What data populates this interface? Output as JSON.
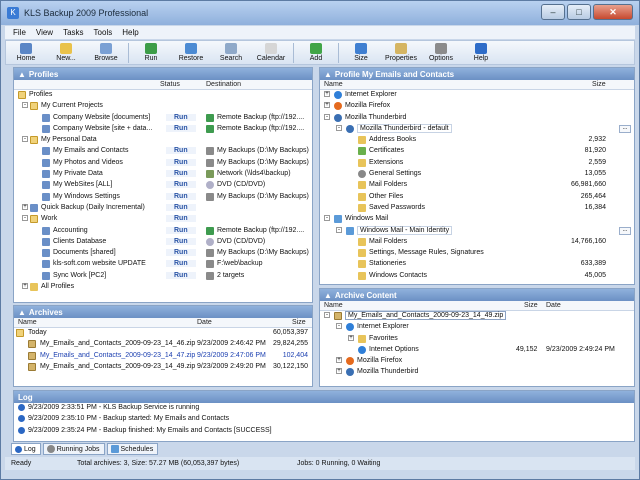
{
  "window": {
    "title": "KLS Backup 2009 Professional",
    "min": "–",
    "max": "□",
    "close": "✕"
  },
  "menu": [
    "File",
    "View",
    "Tasks",
    "Tools",
    "Help"
  ],
  "toolbar": [
    {
      "label": "Home",
      "icon": "home-icon",
      "color": "#5a86c6"
    },
    {
      "label": "New...",
      "icon": "new-icon",
      "color": "#e9c24b"
    },
    {
      "label": "Browse",
      "icon": "browse-icon",
      "color": "#7aa0d4"
    },
    {
      "label": "Run",
      "icon": "run-icon",
      "color": "#3d9d48"
    },
    {
      "label": "Restore",
      "icon": "restore-icon",
      "color": "#4c8bd3"
    },
    {
      "label": "Search",
      "icon": "search-icon",
      "color": "#8fa9c9"
    },
    {
      "label": "Calendar",
      "icon": "calendar-icon",
      "color": "#d6d6d6"
    },
    {
      "label": "Add",
      "icon": "add-icon",
      "color": "#41a547"
    },
    {
      "label": "Size",
      "icon": "size-icon",
      "color": "#3f7fd1"
    },
    {
      "label": "Properties",
      "icon": "properties-icon",
      "color": "#d5b562"
    },
    {
      "label": "Options",
      "icon": "options-icon",
      "color": "#8b8b8b"
    },
    {
      "label": "Help",
      "icon": "help-icon",
      "color": "#2e6cc8"
    }
  ],
  "profiles": {
    "title": "Profiles",
    "columns": {
      "name": "",
      "status": "Status",
      "destination": "Destination"
    },
    "rows": [
      {
        "name": "Profiles",
        "status": "",
        "dest": "",
        "level": 0,
        "icon": "folder-open",
        "exp": ""
      },
      {
        "name": "My Current Projects",
        "status": "",
        "dest": "",
        "level": 1,
        "icon": "folder-open",
        "exp": "-"
      },
      {
        "name": "Company Website [documents]",
        "status": "Run",
        "dest": "Remote Backup (ftp://192....",
        "level": 2,
        "icon": "profile",
        "dicon": "remote"
      },
      {
        "name": "Company Website [site + data...",
        "status": "Run",
        "dest": "Remote Backup (ftp://192....",
        "level": 2,
        "icon": "profile",
        "dicon": "remote"
      },
      {
        "name": "My Personal Data",
        "status": "",
        "dest": "",
        "level": 1,
        "icon": "folder-open",
        "exp": "-"
      },
      {
        "name": "My Emails and Contacts",
        "status": "Run",
        "dest": "My Backups (D:\\My Backups)",
        "level": 2,
        "icon": "profile",
        "dicon": "disk"
      },
      {
        "name": "My Photos and Videos",
        "status": "Run",
        "dest": "My Backups (D:\\My Backups)",
        "level": 2,
        "icon": "profile",
        "dicon": "disk"
      },
      {
        "name": "My Private Data",
        "status": "Run",
        "dest": "Network (\\\\lds4\\backup)",
        "level": 2,
        "icon": "profile",
        "dicon": "net"
      },
      {
        "name": "My WebSites [ALL]",
        "status": "Run",
        "dest": "DVD (CD/DVD)",
        "level": 2,
        "icon": "profile",
        "dicon": "dvd"
      },
      {
        "name": "My Windows Settings",
        "status": "Run",
        "dest": "My Backups (D:\\My Backups)",
        "level": 2,
        "icon": "profile",
        "dicon": "disk"
      },
      {
        "name": "Quick Backup (Daily Incremental)",
        "status": "Run",
        "dest": "",
        "level": 1,
        "icon": "profile",
        "exp": "+"
      },
      {
        "name": "Work",
        "status": "Run",
        "dest": "",
        "level": 1,
        "icon": "folder-open",
        "exp": "-"
      },
      {
        "name": "Accounting",
        "status": "Run",
        "dest": "Remote Backup (ftp://192....",
        "level": 2,
        "icon": "profile",
        "dicon": "remote"
      },
      {
        "name": "Clients Database",
        "status": "Run",
        "dest": "DVD (CD/DVD)",
        "level": 2,
        "icon": "profile",
        "dicon": "dvd"
      },
      {
        "name": "Documents [shared]",
        "status": "Run",
        "dest": "My Backups (D:\\My Backups)",
        "level": 2,
        "icon": "profile",
        "dicon": "disk"
      },
      {
        "name": "kls-soft.com website UPDATE",
        "status": "Run",
        "dest": "F:\\web\\backup",
        "level": 2,
        "icon": "profile",
        "dicon": "disk"
      },
      {
        "name": "Sync Work [PC2]",
        "status": "Run",
        "dest": "2 targets",
        "level": 2,
        "icon": "profile",
        "dicon": "disk"
      },
      {
        "name": "All Profiles",
        "status": "",
        "dest": "",
        "level": 1,
        "icon": "folder",
        "exp": "+"
      }
    ]
  },
  "profile_detail": {
    "title": "Profile My Emails and Contacts",
    "columns": {
      "name": "Name",
      "size": "Size"
    },
    "rows": [
      {
        "name": "Internet Explorer",
        "size": "",
        "level": 0,
        "icon": "ie",
        "exp": "+"
      },
      {
        "name": "Mozilla Firefox",
        "size": "",
        "level": 0,
        "icon": "ff",
        "exp": "+"
      },
      {
        "name": "Mozilla Thunderbird",
        "size": "",
        "level": 0,
        "icon": "tb",
        "exp": "-"
      },
      {
        "name": "Mozilla Thunderbird - default",
        "size": "",
        "level": 1,
        "icon": "tb",
        "exp": "-",
        "ell": true
      },
      {
        "name": "Address Books",
        "size": "2,932",
        "level": 2,
        "icon": "folder"
      },
      {
        "name": "Certificates",
        "size": "81,920",
        "level": 2,
        "icon": "shield"
      },
      {
        "name": "Extensions",
        "size": "2,559",
        "level": 2,
        "icon": "folder"
      },
      {
        "name": "General Settings",
        "size": "13,055",
        "level": 2,
        "icon": "gear"
      },
      {
        "name": "Mail Folders",
        "size": "66,981,660",
        "level": 2,
        "icon": "folder"
      },
      {
        "name": "Other Files",
        "size": "265,464",
        "level": 2,
        "icon": "folder"
      },
      {
        "name": "Saved Passwords",
        "size": "16,384",
        "level": 2,
        "icon": "folder"
      },
      {
        "name": "Windows Mail",
        "size": "",
        "level": 0,
        "icon": "mail",
        "exp": "-"
      },
      {
        "name": "Windows Mail - Main Identity",
        "size": "",
        "level": 1,
        "icon": "mail",
        "exp": "-",
        "ell": true
      },
      {
        "name": "Mail Folders",
        "size": "14,766,160",
        "level": 2,
        "icon": "folder"
      },
      {
        "name": "Settings, Message Rules, Signatures",
        "size": "",
        "level": 2,
        "icon": "folder"
      },
      {
        "name": "Stationeries",
        "size": "633,389",
        "level": 2,
        "icon": "folder"
      },
      {
        "name": "Windows Contacts",
        "size": "45,005",
        "level": 2,
        "icon": "folder"
      }
    ]
  },
  "archives": {
    "title": "Archives",
    "columns": {
      "name": "Name",
      "date": "Date",
      "size": "Size"
    },
    "rows": [
      {
        "name": "Today",
        "date": "",
        "size": "60,053,397",
        "blue": false,
        "icon": "folder-open",
        "exp": "-"
      },
      {
        "name": "My_Emails_and_Contacts_2009-09-23_14_46.zip",
        "date": "9/23/2009 2:46:42 PM",
        "size": "29,824,255",
        "blue": false,
        "icon": "zip"
      },
      {
        "name": "My_Emails_and_Contacts_2009-09-23_14_47.zip",
        "date": "9/23/2009 2:47:06 PM",
        "size": "102,404",
        "blue": true,
        "icon": "zip"
      },
      {
        "name": "My_Emails_and_Contacts_2009-09-23_14_49.zip",
        "date": "9/23/2009 2:49:20 PM",
        "size": "30,122,150",
        "blue": false,
        "icon": "zip"
      }
    ]
  },
  "archive_content": {
    "title": "Archive Content",
    "columns": {
      "name": "Name",
      "size": "Size",
      "date": "Date"
    },
    "rows": [
      {
        "name": "My_Emails_and_Contacts_2009-09-23_14_49.zip",
        "size": "",
        "date": "",
        "level": 0,
        "icon": "zip",
        "exp": "-",
        "boxed": true
      },
      {
        "name": "Internet Explorer",
        "size": "",
        "date": "",
        "level": 1,
        "icon": "ie",
        "exp": "-"
      },
      {
        "name": "Favorites",
        "size": "",
        "date": "",
        "level": 2,
        "icon": "folder",
        "exp": "+"
      },
      {
        "name": "Internet Options",
        "size": "49,152",
        "date": "9/23/2009 2:49:24 PM",
        "level": 2,
        "icon": "ie"
      },
      {
        "name": "Mozilla Firefox",
        "size": "",
        "date": "",
        "level": 1,
        "icon": "ff",
        "exp": "+"
      },
      {
        "name": "Mozilla Thunderbird",
        "size": "",
        "date": "",
        "level": 1,
        "icon": "tb",
        "exp": "+"
      }
    ]
  },
  "log": {
    "title": "Log",
    "entries": [
      "9/23/2009 2:33:51 PM - KLS Backup Service is running",
      "9/23/2009 2:35:10 PM - Backup started: My Emails and Contacts",
      "9/23/2009 2:35:24 PM - Backup finished: My Emails and Contacts [SUCCESS]"
    ],
    "tabs": [
      "Log",
      "Running Jobs",
      "Schedules"
    ]
  },
  "status": {
    "ready": "Ready",
    "archives": "Total archives: 3, Size: 57.27 MB (60,053,397 bytes)",
    "jobs": "Jobs: 0 Running, 0 Waiting"
  }
}
